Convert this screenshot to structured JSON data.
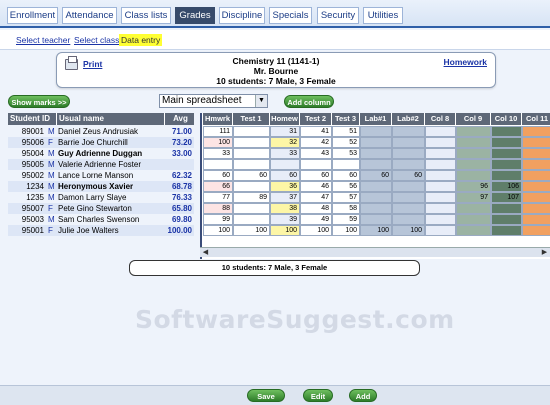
{
  "tabs": [
    "Enrollment",
    "Attendance",
    "Class lists",
    "Grades",
    "Discipline",
    "Specials",
    "Security",
    "Utilities"
  ],
  "active_tab": "Grades",
  "subnav": [
    "Select teacher",
    "Select class",
    "Data entry"
  ],
  "active_subnav": "Data entry",
  "info": {
    "print_label": "Print",
    "course": "Chemistry 11 (1141-1)",
    "teacher": "Mr. Bourne",
    "summary": "10 students: 7 Male, 3 Female",
    "homework_label": "Homework"
  },
  "toolbar": {
    "show_marks_label": "Show marks >>",
    "view_select_value": "Main spreadsheet",
    "add_column_label": "Add column"
  },
  "left_headers": [
    "Student ID",
    "Usual name",
    "Avg"
  ],
  "students": [
    {
      "id": "89001",
      "sex": "M",
      "name": "Daniel Zeus Andrusiak",
      "avg": "71.00",
      "bold": false
    },
    {
      "id": "95006",
      "sex": "F",
      "name": "Barrie Joe Churchill",
      "avg": "73.20",
      "bold": false
    },
    {
      "id": "95004",
      "sex": "M",
      "name": "Guy Adrienne Duggan",
      "avg": "33.00",
      "bold": true
    },
    {
      "id": "95005",
      "sex": "M",
      "name": "Valerie Adrienne Foster",
      "avg": "",
      "bold": false
    },
    {
      "id": "95002",
      "sex": "M",
      "name": "Lance Lorne Manson",
      "avg": "62.32",
      "bold": false
    },
    {
      "id": "1234",
      "sex": "M",
      "name": "Heronymous Xavier",
      "avg": "68.78",
      "bold": true
    },
    {
      "id": "1235",
      "sex": "M",
      "name": "Damon Larry Slaye",
      "avg": "76.33",
      "bold": false
    },
    {
      "id": "95007",
      "sex": "F",
      "name": "Pete Gino Stewarton",
      "avg": "65.80",
      "bold": false
    },
    {
      "id": "95003",
      "sex": "M",
      "name": "Sam Charles Swenson",
      "avg": "69.80",
      "bold": false
    },
    {
      "id": "95001",
      "sex": "F",
      "name": "Julie Joe Walters",
      "avg": "100.00",
      "bold": false
    }
  ],
  "mark_headers": [
    "Hmwrk",
    "Test 1",
    "Homew",
    "Test 2",
    "Test 3",
    "Lab#1",
    "Lab#2",
    "Col 8",
    "Col 9",
    "Col 10",
    "Col 11"
  ],
  "marks": [
    [
      "111",
      "",
      "31",
      "41",
      "51",
      "",
      "",
      "",
      "",
      "",
      ""
    ],
    [
      "100",
      "",
      "32",
      "42",
      "52",
      "",
      "",
      "",
      "",
      "",
      ""
    ],
    [
      "33",
      "",
      "33",
      "43",
      "53",
      "",
      "",
      "",
      "",
      "",
      ""
    ],
    [
      "",
      "",
      "",
      "",
      "",
      "",
      "",
      "",
      "",
      "",
      ""
    ],
    [
      "60",
      "60",
      "60",
      "60",
      "60",
      "60",
      "60",
      "",
      "",
      "",
      ""
    ],
    [
      "66",
      "",
      "36",
      "46",
      "56",
      "",
      "",
      "",
      "96",
      "106",
      ""
    ],
    [
      "77",
      "89",
      "37",
      "47",
      "57",
      "",
      "",
      "",
      "97",
      "107",
      ""
    ],
    [
      "88",
      "",
      "38",
      "48",
      "58",
      "",
      "",
      "",
      "",
      "",
      ""
    ],
    [
      "99",
      "",
      "39",
      "49",
      "59",
      "",
      "",
      "",
      "",
      "",
      ""
    ],
    [
      "100",
      "100",
      "100",
      "100",
      "100",
      "100",
      "100",
      "",
      "",
      "",
      ""
    ]
  ],
  "footer_summary": "10 students: 7 Male, 3 Female",
  "watermark": "SoftwareSuggest.com",
  "footer_buttons": [
    "Save",
    "Edit",
    "Add"
  ]
}
